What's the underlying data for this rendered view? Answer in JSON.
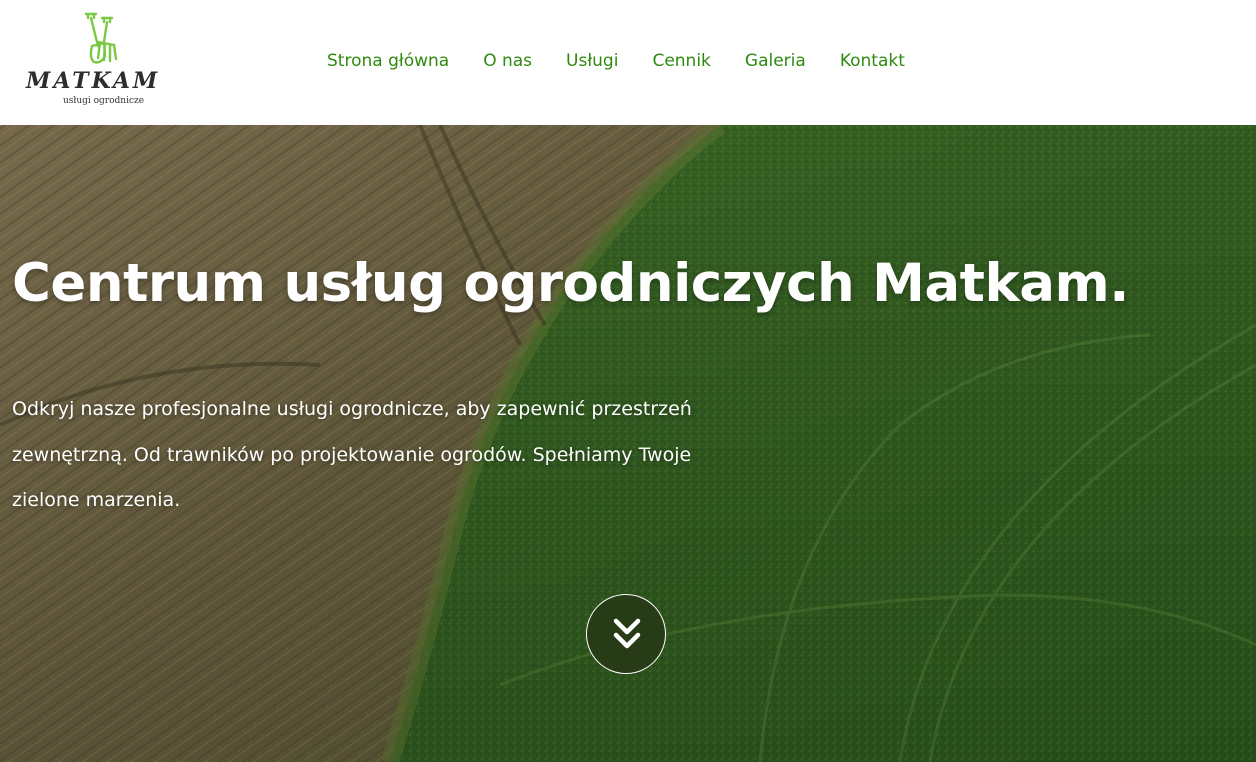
{
  "header": {
    "logo": {
      "name": "MATKAM",
      "tagline": "usługi ogrodnicze",
      "icon": "shovel-and-fork-icon",
      "icon_color": "#7ac943"
    },
    "nav": {
      "items": [
        {
          "label": "Strona główna"
        },
        {
          "label": "O nas"
        },
        {
          "label": "Usługi"
        },
        {
          "label": "Cennik"
        },
        {
          "label": "Galeria"
        },
        {
          "label": "Kontakt"
        }
      ],
      "color": "#2f8a0f"
    }
  },
  "hero": {
    "title": "Centrum usług ogrodniczych Matkam.",
    "text": "Odkryj nasze profesjonalne usługi ogrodnicze, aby zapewnić przestrzeń zewnętrzną. Od trawników po projektowanie ogrodów. Spełniamy Twoje zielone marzenia.",
    "scroll_button_icon": "double-chevron-down-icon",
    "background": "aerial-field-photo"
  }
}
